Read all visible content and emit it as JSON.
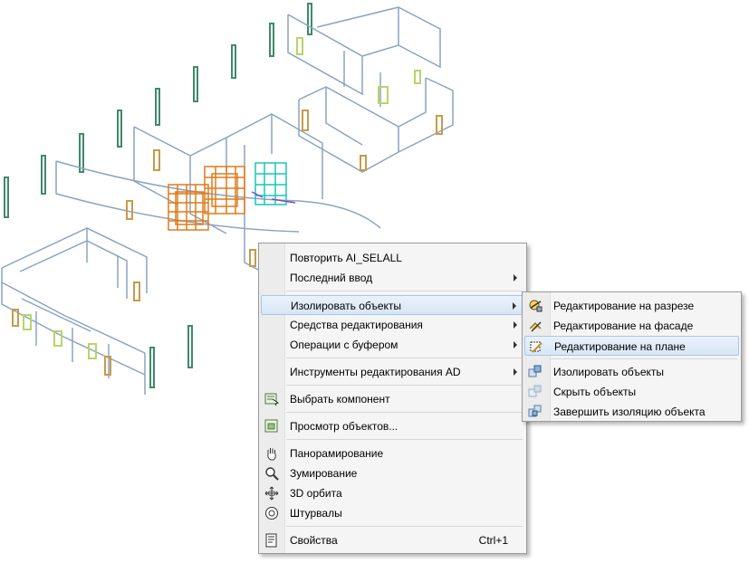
{
  "context_menu": {
    "items": [
      {
        "label": "Повторить AI_SELALL",
        "submenu": false
      },
      {
        "label": "Последний ввод",
        "submenu": true
      },
      {
        "label": "Изолировать объекты",
        "submenu": true,
        "highlighted": true
      },
      {
        "label": "Средства редактирования",
        "submenu": true
      },
      {
        "label": "Операции с буфером",
        "submenu": true
      },
      {
        "label": "Инструменты редактирования AD",
        "submenu": true
      },
      {
        "label": "Выбрать компонент",
        "icon": "select-component-icon"
      },
      {
        "label": "Просмотр объектов...",
        "icon": "object-viewer-icon"
      },
      {
        "label": "Панорамирование",
        "icon": "pan-hand-icon"
      },
      {
        "label": "Зумирование",
        "icon": "zoom-icon"
      },
      {
        "label": "3D орбита",
        "icon": "orbit-icon"
      },
      {
        "label": "Штурвалы",
        "icon": "steering-wheel-icon"
      },
      {
        "label": "Свойства",
        "icon": "properties-icon",
        "shortcut": "Ctrl+1"
      }
    ]
  },
  "submenu": {
    "items": [
      {
        "label": "Редактирование на разрезе",
        "icon": "section-edit-icon"
      },
      {
        "label": "Редактирование на фасаде",
        "icon": "elevation-edit-icon"
      },
      {
        "label": "Редактирование на плане",
        "icon": "plan-edit-icon",
        "highlighted": true
      },
      {
        "label": "Изолировать объекты",
        "icon": "isolate-objects-icon"
      },
      {
        "label": "Скрыть объекты",
        "icon": "hide-objects-icon"
      },
      {
        "label": "Завершить изоляцию объекта",
        "icon": "end-isolation-icon"
      }
    ]
  },
  "colors": {
    "wall": "#8aa4c0",
    "wall_dark": "#5b7c9e",
    "column": "#3f8a6a",
    "door": "#c89a4a",
    "window": "#b7d46a",
    "cluster_orange": "#e07a1a",
    "cluster_cyan": "#19c7b5",
    "highlight": "#d7e6f6"
  }
}
